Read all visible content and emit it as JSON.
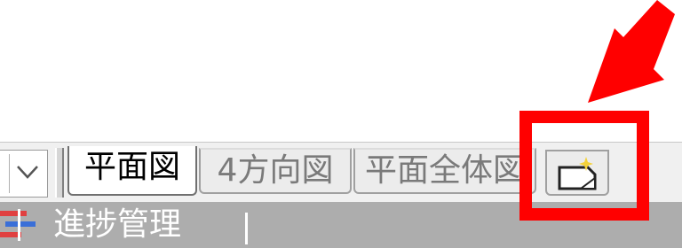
{
  "tabs": [
    {
      "label": "平面図",
      "active": true
    },
    {
      "label": "4方向図",
      "active": false
    },
    {
      "label": "平面全体図",
      "active": false
    }
  ],
  "new_tab_icon": "new-sheet-sparkle-icon",
  "view_selector_icon": "chevron-down-icon",
  "status_bar": {
    "icon": "progress-management-icon",
    "label": "進捗管理"
  },
  "annotation": {
    "color": "#ff0000",
    "shapes": [
      "red-arrow",
      "red-rectangle"
    ]
  }
}
